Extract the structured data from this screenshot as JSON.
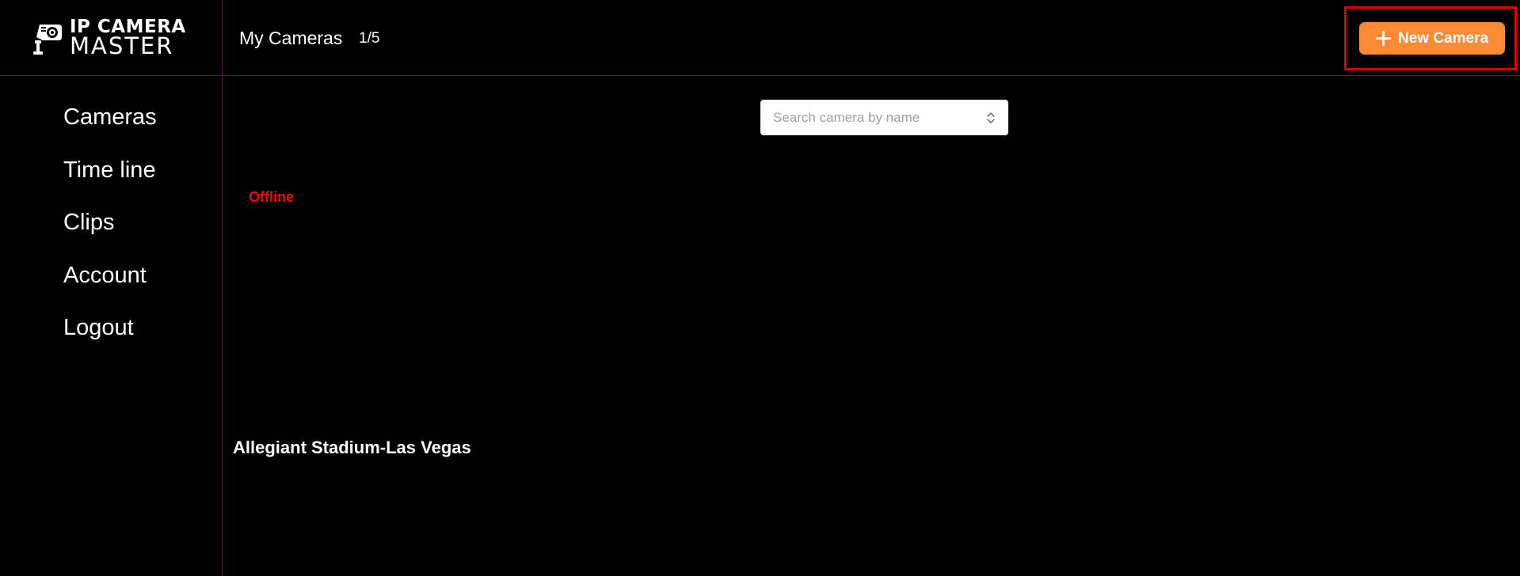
{
  "logo": {
    "line1": "IP CAMERA",
    "line2": "MASTER",
    "icon": "camera-icon"
  },
  "header": {
    "title": "My Cameras",
    "count": "1/5",
    "new_camera_label": "New Camera",
    "new_camera_icon": "plus-icon"
  },
  "sidebar": {
    "items": [
      {
        "label": "Cameras"
      },
      {
        "label": "Time line"
      },
      {
        "label": "Clips"
      },
      {
        "label": "Account"
      },
      {
        "label": "Logout"
      }
    ]
  },
  "search": {
    "placeholder": "Search camera by name",
    "value": "",
    "icon": "chevron-up-down-icon"
  },
  "cameras": [
    {
      "status": "Offline",
      "name": "Allegiant Stadium-Las Vegas"
    }
  ],
  "colors": {
    "background": "#000000",
    "accent": "#fb8a35",
    "divider": "#5a1450",
    "offline": "#ff0000",
    "highlight": "#e00000"
  }
}
